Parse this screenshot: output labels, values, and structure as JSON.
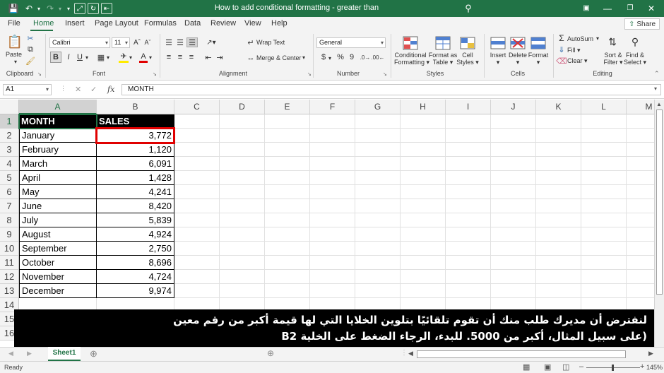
{
  "window": {
    "title": "How to add conditional formatting - greater than",
    "brand_color": "#217346"
  },
  "tabs": [
    "File",
    "Home",
    "Insert",
    "Page Layout",
    "Formulas",
    "Data",
    "Review",
    "View",
    "Help"
  ],
  "share_label": "Share",
  "ribbon": {
    "clipboard": {
      "paste": "Paste",
      "label": "Clipboard"
    },
    "font": {
      "name": "Calibri",
      "size": "11",
      "bold": "B",
      "italic": "I",
      "underline": "U",
      "label": "Font"
    },
    "alignment": {
      "wrap_text": "Wrap Text",
      "merge_center": "Merge & Center",
      "label": "Alignment"
    },
    "number": {
      "format": "General",
      "currency": "$",
      "percent": "%",
      "comma": "9",
      "label": "Number"
    },
    "styles": {
      "conditional_1": "Conditional",
      "conditional_2": "Formatting",
      "format_table_1": "Format as",
      "format_table_2": "Table",
      "cell_styles_1": "Cell",
      "cell_styles_2": "Styles",
      "label": "Styles"
    },
    "cells": {
      "insert": "Insert",
      "delete": "Delete",
      "format": "Format",
      "label": "Cells"
    },
    "editing": {
      "autosum": "AutoSum",
      "fill": "Fill",
      "clear": "Clear",
      "sort_1": "Sort &",
      "sort_2": "Filter",
      "find_1": "Find &",
      "find_2": "Select",
      "label": "Editing"
    }
  },
  "formula_bar": {
    "cell_ref": "A1",
    "fx": "fx",
    "content": "MONTH"
  },
  "columns": [
    "A",
    "B",
    "C",
    "D",
    "E",
    "F",
    "G",
    "H",
    "I",
    "J",
    "K",
    "L",
    "M"
  ],
  "rows": [
    "1",
    "2",
    "3",
    "4",
    "5",
    "6",
    "7",
    "8",
    "9",
    "10",
    "11",
    "12",
    "13",
    "14",
    "15",
    "16"
  ],
  "table": {
    "headers": [
      "MONTH",
      "SALES"
    ],
    "data": [
      [
        "January",
        "3,772"
      ],
      [
        "February",
        "1,120"
      ],
      [
        "March",
        "6,091"
      ],
      [
        "April",
        "1,428"
      ],
      [
        "May",
        "4,241"
      ],
      [
        "June",
        "8,420"
      ],
      [
        "July",
        "5,839"
      ],
      [
        "August",
        "4,924"
      ],
      [
        "September",
        "2,750"
      ],
      [
        "October",
        "8,696"
      ],
      [
        "November",
        "4,724"
      ],
      [
        "December",
        "9,974"
      ]
    ]
  },
  "caption": {
    "line1": "لنفترض أن مديرك طلب منك أن تقوم تلقائيًا بتلوين الخلايا التي لها قيمة أكبر من رقم معين",
    "line2": "(على سبيل المثال، أكبر من 5000. للبدء، الرجاء الضغط على الخلية B2"
  },
  "sheet_tab": "Sheet1",
  "status": {
    "ready": "Ready",
    "zoom": "145%"
  },
  "highlight_color": "#e00000"
}
